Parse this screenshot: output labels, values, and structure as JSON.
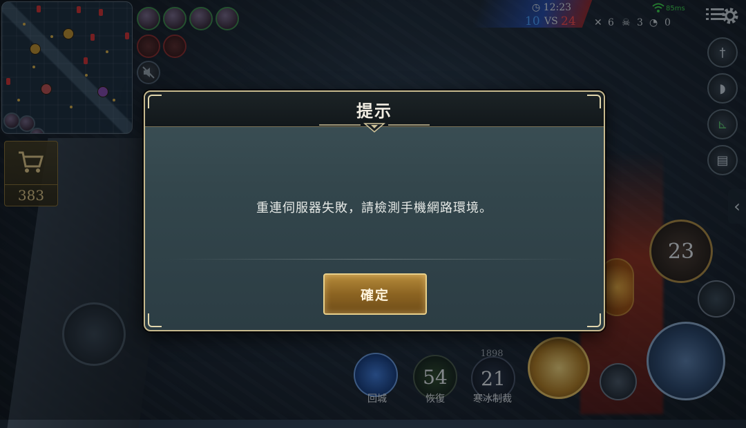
{
  "hud": {
    "clock": "12:23",
    "score_blue": "10",
    "score_vs": "VS",
    "score_red": "24",
    "kills": "6",
    "deaths": "3",
    "assists": "0",
    "ping": "85ms",
    "gold": "383"
  },
  "skills": {
    "recall_label": "回城",
    "heal_label": "恢復",
    "heal_cooldown": "54",
    "spell_label": "寒冰制裁",
    "spell_cooldown": "21",
    "spell_top_value": "1898",
    "ultimate_cooldown": "23"
  },
  "dialog": {
    "title": "提示",
    "message": "重連伺服器失敗，請檢測手機網路環境。",
    "confirm_label": "確定"
  },
  "colors": {
    "team_blue": "#4aa0ff",
    "team_red": "#ff4a4a",
    "gold_accent": "#c7b98e",
    "button_gold": "#8c6422",
    "ping_green": "#3cd04a"
  },
  "icons": [
    "clock-icon",
    "swords-icon",
    "skull-icon",
    "assist-icon",
    "wifi-icon",
    "menu-icon",
    "gear-icon",
    "cart-icon",
    "sword-icon",
    "helmet-icon",
    "boot-icon",
    "chat-icon",
    "chevron-left-icon",
    "mute-icon"
  ]
}
